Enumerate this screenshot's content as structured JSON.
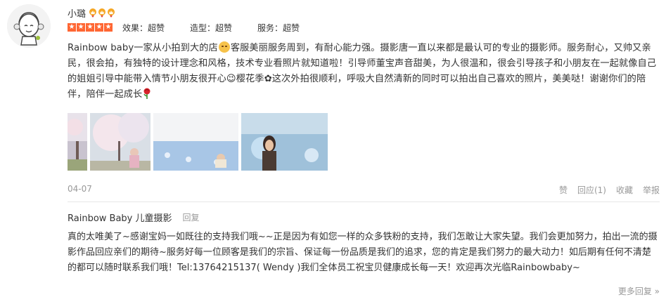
{
  "review": {
    "username": "小璐",
    "rating_stars": 5,
    "sub_ratings": [
      {
        "label": "效果：超赞"
      },
      {
        "label": "造型：超赞"
      },
      {
        "label": "服务：超赞"
      }
    ],
    "text_part1": "Rainbow baby一家从小拍到大的店",
    "text_part2": "客服美丽服务周到，有耐心能力强。摄影唐一直以来都是最认可的专业的摄影师。服务耐心，又帅又亲民，很会拍，有独特的设计理念和风格，技术专业看照片就知道啦！引导师董宝声音甜美，为人很温和，很会引导孩子和小朋友在一起就像自己的姐姐引导中能带入情节小朋友很开心😉樱花季✿这次外拍很顺利，呼吸大自然清新的同时可以拍出自己喜欢的照片，美美哒！谢谢你们的陪伴，陪伴一起成长",
    "date": "04-07",
    "actions": {
      "like": "赞",
      "reply": "回应(1)",
      "favorite": "收藏",
      "report": "举报"
    }
  },
  "merchant_reply": {
    "author": "Rainbow Baby 儿童摄影",
    "reply_link": "回复",
    "text": "真的太唯美了~感谢宝妈一如既往的支持我们哦~~正是因为有如您一样的众多铁粉的支持，我们怎敢让大家失望。我们会更加努力，拍出一流的摄影作品回应亲们的期待~服务好每一位顾客是我们的宗旨、保证每一份品质是我们的追求，您的肯定是我们努力的最大动力！如后期有任何不清楚的都可以随时联系我们哦！Tel:13764215137( Wendy )我们全体员工祝宝贝健康成长每一天！欢迎再次光临Rainbowbaby~"
  },
  "more_replies": "更多回复 »",
  "colors": {
    "star": "#ff6633",
    "vip": "#f5a623",
    "muted": "#999999",
    "divider": "#e6e6e6"
  }
}
